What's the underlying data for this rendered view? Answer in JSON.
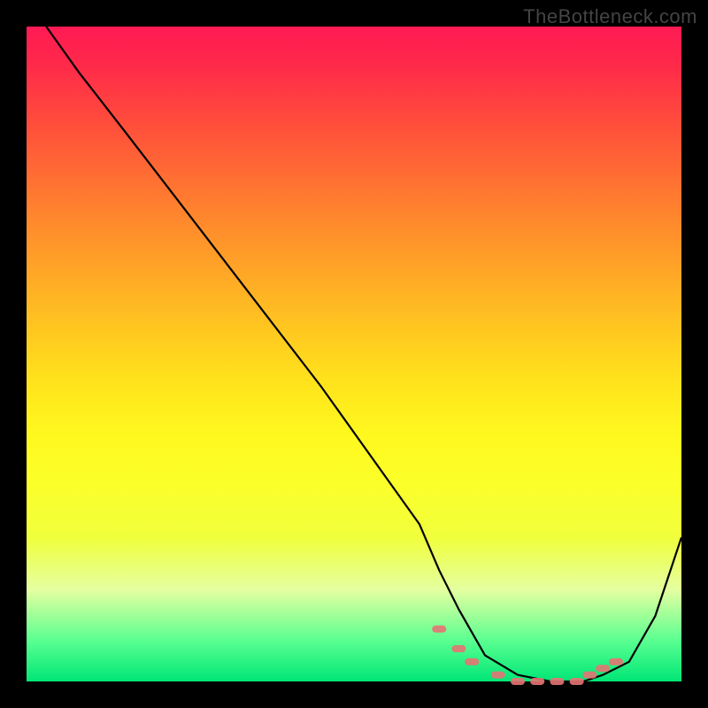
{
  "watermark": "TheBottleneck.com",
  "chart_data": {
    "type": "line",
    "title": "",
    "xlabel": "",
    "ylabel": "",
    "xlim": [
      0,
      100
    ],
    "ylim": [
      0,
      100
    ],
    "grid": false,
    "legend": false,
    "background": "rainbow-gradient",
    "series": [
      {
        "name": "curve",
        "color": "#000000",
        "x": [
          3,
          8,
          15,
          25,
          35,
          45,
          55,
          60,
          63,
          66,
          70,
          75,
          80,
          85,
          88,
          92,
          96,
          100
        ],
        "y": [
          100,
          93,
          84,
          71,
          58,
          45,
          31,
          24,
          17,
          11,
          4,
          1,
          0,
          0,
          1,
          3,
          10,
          22
        ]
      }
    ],
    "markers": {
      "name": "highlight-dots",
      "color": "#e57373",
      "points": [
        {
          "x": 63,
          "y": 8
        },
        {
          "x": 66,
          "y": 5
        },
        {
          "x": 68,
          "y": 3
        },
        {
          "x": 72,
          "y": 1
        },
        {
          "x": 75,
          "y": 0
        },
        {
          "x": 78,
          "y": 0
        },
        {
          "x": 81,
          "y": 0
        },
        {
          "x": 84,
          "y": 0
        },
        {
          "x": 86,
          "y": 1
        },
        {
          "x": 88,
          "y": 2
        },
        {
          "x": 90,
          "y": 3
        }
      ]
    }
  }
}
